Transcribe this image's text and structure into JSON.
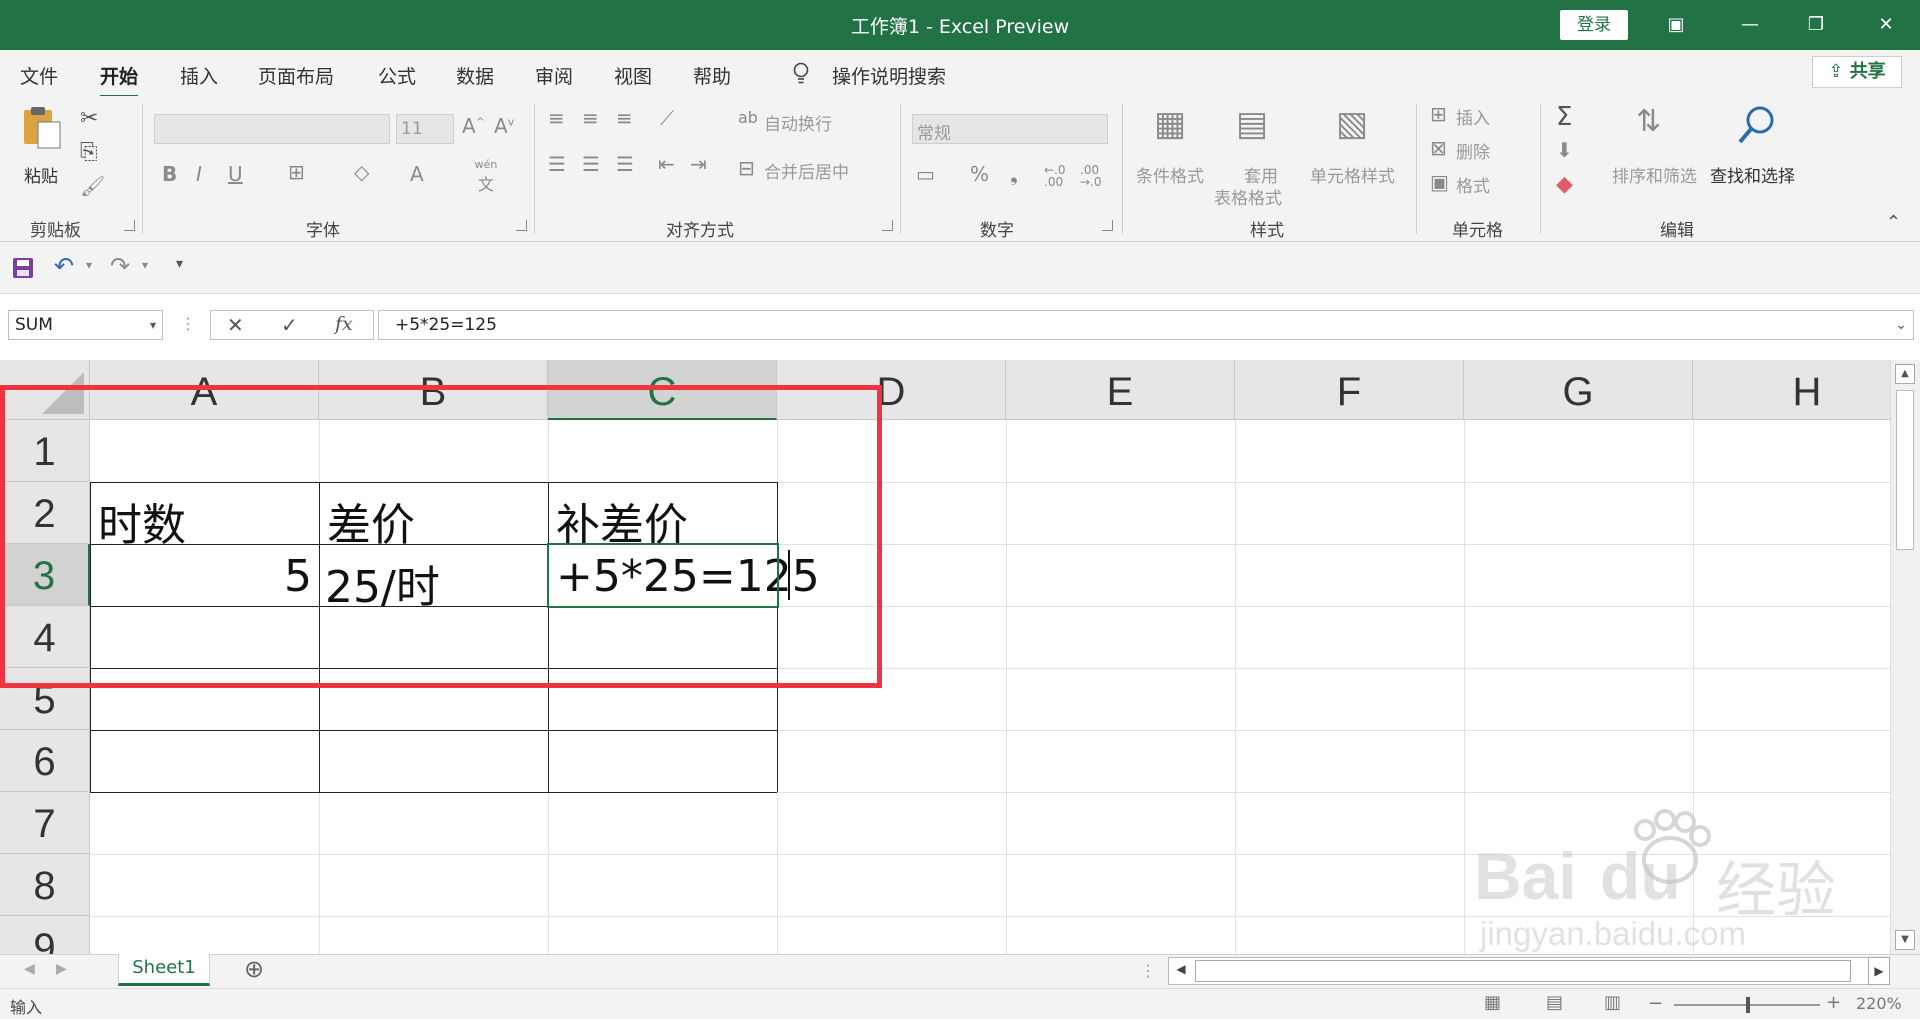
{
  "window": {
    "title": "工作簿1  -  Excel Preview",
    "login": "登录",
    "ribbon_display_icon": "▣",
    "minimize_icon": "—",
    "restore_icon": "❐",
    "close_icon": "✕"
  },
  "tabs": [
    "文件",
    "开始",
    "插入",
    "页面布局",
    "公式",
    "数据",
    "审阅",
    "视图",
    "帮助"
  ],
  "active_tab": "开始",
  "tell_me": "操作说明搜索",
  "share": "共享",
  "ribbon": {
    "clipboard": {
      "label": "剪贴板",
      "paste": "粘贴"
    },
    "font": {
      "label": "字体",
      "size": "11",
      "bold": "B",
      "italic": "I",
      "underline": "U",
      "font_color_glyph": "A",
      "phonetic_top": "wén",
      "phonetic_bottom": "文"
    },
    "alignment": {
      "label": "对齐方式",
      "wrap": "自动换行",
      "merge": "合并后居中"
    },
    "number": {
      "label": "数字",
      "format": "常规",
      "percent": "%",
      "comma": "❟",
      "inc_decimal": "←.0 .00",
      "dec_decimal": ".00 →.0"
    },
    "styles": {
      "label": "样式",
      "conditional": "条件格式",
      "table_format_1": "套用",
      "table_format_2": "表格格式",
      "cell_styles": "单元格样式"
    },
    "cells": {
      "label": "单元格",
      "insert": "插入",
      "delete": "删除",
      "format": "格式"
    },
    "editing": {
      "label": "编辑",
      "sort_filter": "排序和筛选",
      "find_select": "查找和选择"
    }
  },
  "formula_bar": {
    "name_box": "SUM",
    "cancel_icon": "✕",
    "enter_icon": "✓",
    "fx": "fx",
    "content": "+5*25=125"
  },
  "columns": [
    "A",
    "B",
    "C",
    "D",
    "E",
    "F",
    "G",
    "H"
  ],
  "rows": [
    "1",
    "2",
    "3",
    "4",
    "5",
    "6",
    "7",
    "8",
    "9"
  ],
  "selected_column": "C",
  "selected_row": "3",
  "cells": {
    "A2": "时数",
    "B2": "差价",
    "C2": "补差价",
    "A3": "5",
    "B3": "25/时",
    "C3": "+5*25=125"
  },
  "sheet_tab": "Sheet1",
  "add_sheet_icon": "⊕",
  "status": {
    "mode": "输入",
    "zoom": "220%"
  },
  "watermark": {
    "line1": "Bai",
    "line2": "du",
    "line3": "经验",
    "line4": "jingyan.baidu.com"
  },
  "colors": {
    "excel_green": "#217346",
    "highlight_red": "#ef3340"
  }
}
